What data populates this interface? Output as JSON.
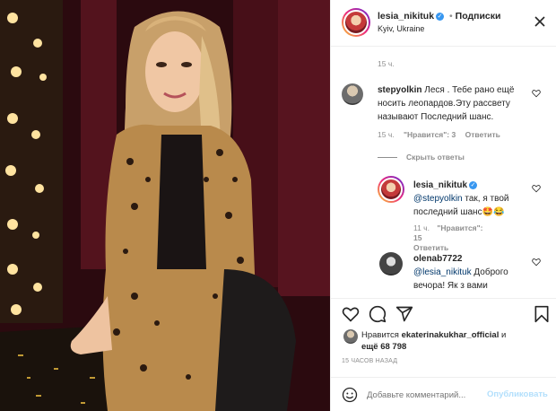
{
  "post": {
    "username": "lesia_nikituk",
    "separator": "•",
    "follow_label": "Подписки",
    "location": "Kyiv, Ukraine"
  },
  "comments": {
    "first_time": "15 ч.",
    "c1": {
      "username": "stepyolkin",
      "text": "Леся . Тебе рано ещё носить леопардов.Эту рассвету называют Последний шанс.",
      "line1": "Леся . Тебе рано ещё",
      "line2": "носить леопардов.Эту рассвету",
      "line3": "называют Последний шанс.",
      "time": "15 ч.",
      "likes": "\"Нравится\": 3",
      "reply": "Ответить",
      "hide_replies": "Скрыть ответы"
    },
    "r1": {
      "username": "lesia_nikituk",
      "mention": "@stepyolkin",
      "line1": " так, я твой",
      "line2": "последний шанс🤩😂",
      "time": "11 ч.",
      "likes": "\"Нравится\": 15",
      "reply": "Ответить"
    },
    "r2": {
      "username": "olenab7722",
      "mention": "@lesia_nikituk",
      "line1": " Доброго",
      "line2": "вечора! Як з вами"
    }
  },
  "likes": {
    "prefix": "Нравится",
    "user": "ekaterinakukhar_official",
    "conj": "и",
    "more": "ещё 68 798",
    "time": "15 ЧАСОВ НАЗАД"
  },
  "add_comment": {
    "placeholder": "Добавьте комментарий...",
    "publish": "Опубликовать"
  },
  "icons": [
    "more-icon",
    "heart-icon",
    "comment-icon",
    "share-icon",
    "bookmark-icon",
    "emoji-icon"
  ],
  "colors": {
    "accent": "#0095f6",
    "verified": "#3897f0",
    "muted": "#8e8e8e"
  }
}
